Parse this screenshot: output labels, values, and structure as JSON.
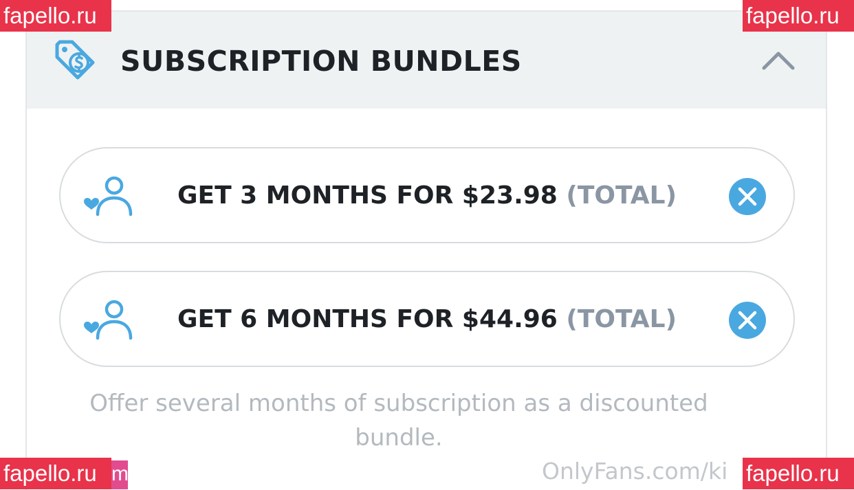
{
  "header": {
    "title": "SUBSCRIPTION BUNDLES",
    "icon": "price-tag-dollar-icon",
    "collapse_icon": "chevron-up-icon"
  },
  "bundles": [
    {
      "main_text": "GET 3 MONTHS FOR $23.98",
      "suffix": "(TOTAL)",
      "icon": "user-heart-icon",
      "remove_icon": "close-circle-icon"
    },
    {
      "main_text": "GET 6 MONTHS FOR $44.96",
      "suffix": "(TOTAL)",
      "icon": "user-heart-icon",
      "remove_icon": "close-circle-icon"
    }
  ],
  "hint": "Offer several months of subscription as a discounted bundle.",
  "watermarks": {
    "site_badge": "fapello.ru",
    "footer_text": "OnlyFans.com/ki",
    "pink_tail": "m"
  },
  "colors": {
    "accent": "#00aff0",
    "icon_blue": "#4aa8e0",
    "badge_red": "#e8334a",
    "header_bg": "#eff2f3",
    "text_dark": "#1e2226",
    "text_muted": "#8a96a3"
  }
}
